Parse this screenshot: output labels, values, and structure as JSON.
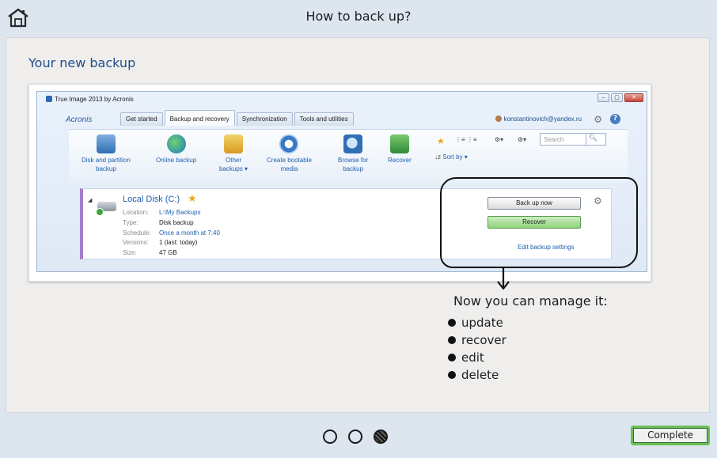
{
  "header": {
    "title": "How to back up?",
    "home_icon": "home-icon"
  },
  "panel": {
    "heading": "Your new backup"
  },
  "app_window": {
    "title": "True Image 2013 by Acronis",
    "brand": "Acronis",
    "tabs": [
      {
        "label": "Get started",
        "active": false
      },
      {
        "label": "Backup and recovery",
        "active": true
      },
      {
        "label": "Synchronization",
        "active": false
      },
      {
        "label": "Tools and utilities",
        "active": false
      }
    ],
    "user": "konstantinovich@yandex.ru",
    "toolbar": {
      "disk_backup": [
        "Disk and partition",
        "backup"
      ],
      "online_backup": "Online backup",
      "other_backups": [
        "Other",
        "backups ▾"
      ],
      "bootable": [
        "Create bootable",
        "media"
      ],
      "browse": [
        "Browse for",
        "backup"
      ],
      "recover": "Recover",
      "sort_by": "Sort by ▾",
      "search_placeholder": "Search"
    },
    "backup_item": {
      "name": "Local Disk (C:)",
      "props": [
        {
          "key": "Location:",
          "value": "L:\\My Backups",
          "link": true
        },
        {
          "key": "Type:",
          "value": "Disk backup",
          "link": false
        },
        {
          "key": "Schedule:",
          "value": "Once a month at 7:40",
          "link": true
        },
        {
          "key": "Versions:",
          "value": "1 (last: today)",
          "link": false
        },
        {
          "key": "Size:",
          "value": "47 GB",
          "link": false
        }
      ],
      "back_up_now": "Back up now",
      "recover": "Recover",
      "edit_settings": "Edit backup settings"
    }
  },
  "manage": {
    "title": "Now you can manage it:",
    "items": [
      "update",
      "recover",
      "edit",
      "delete"
    ]
  },
  "pager": {
    "total": 3,
    "current": 3
  },
  "footer": {
    "complete_label": "Complete"
  }
}
